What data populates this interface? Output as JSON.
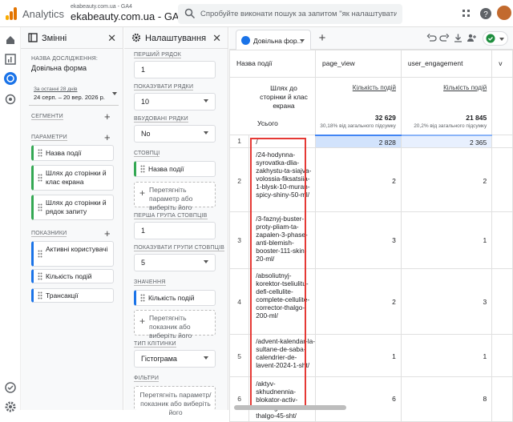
{
  "topbar": {
    "app_name": "Analytics",
    "account_small": "ekabeauty.com.ua - GA4",
    "property": "ekabeauty.com.ua - GA4",
    "search_placeholder": "Спробуйте виконати пошук за запитом \"як налаштувати Ап..."
  },
  "variables_panel": {
    "title": "Змінні",
    "exploration_label": "НАЗВА ДОСЛІДЖЕННЯ:",
    "exploration_name": "Довільна форма",
    "date_label": "За останні 28 днів",
    "date_range": "24 серп. – 20 вер. 2026 р.",
    "segments_label": "СЕГМЕНТИ",
    "dimensions_label": "ПАРАМЕТРИ",
    "dimensions": [
      "Назва події",
      "Шлях до сторінки й клас екрана",
      "Шлях до сторінки й рядок запиту"
    ],
    "metrics_label": "ПОКАЗНИКИ",
    "metrics": [
      "Активні користувачі",
      "Кількість подій",
      "Трансакції"
    ]
  },
  "settings_panel": {
    "title": "Налаштування",
    "first_row_label": "ПЕРШИЙ РЯДОК",
    "first_row": "1",
    "show_rows_label": "ПОКАЗУВАТИ РЯДКИ",
    "show_rows": "10",
    "nested_rows_label": "ВБУДОВАНІ РЯДКИ",
    "nested_rows": "No",
    "columns_label": "СТОВПЦІ",
    "column_chip": "Назва події",
    "drop_dimension": "Перетягніть параметр або виберіть його",
    "first_col_group_label": "ПЕРША ГРУПА СТОВПЦІВ",
    "first_col_group": "1",
    "show_col_groups_label": "ПОКАЗУВАТИ ГРУПИ СТОВПЦІВ",
    "show_col_groups": "5",
    "values_label": "ЗНАЧЕННЯ",
    "value_chip": "Кількість подій",
    "drop_metric": "Перетягніть показник або виберіть його",
    "cell_type_label": "ТИП КЛІТИНКИ",
    "cell_type": "Гістограма",
    "filters_label": "ФІЛЬТРИ",
    "drop_filter": "Перетягніть параметр/ показник або виберіть його"
  },
  "report": {
    "tab_name": "Довільна фор...",
    "header_dim": "Назва події",
    "col1": "page_view",
    "col2": "user_engagement",
    "col3": "v",
    "row_dim_label": "Шлях до сторінки й клас екрана",
    "metric_label": "Кількість подій",
    "totals_label": "Усього",
    "total1": "32 629",
    "total1_pct": "30,18% від загального підсумку",
    "total2": "21 845",
    "total2_pct": "20,2% від загального підсумку",
    "rows": [
      {
        "n": "1",
        "path": "/",
        "v1": "2 828",
        "v2": "2 365"
      },
      {
        "n": "2",
        "path": "/24-hodynna-syrovatka-dlia-zakhystu-ta-siajva-volossia-fiksatsiia-1-blysk-10-muran-spicy-shiny-50-ml/",
        "v1": "2",
        "v2": "2"
      },
      {
        "n": "3",
        "path": "/3-faznyj-buster-proty-pliam-ta-zapalen-3-phase-anti-blemish-booster-111-skin-20-ml/",
        "v1": "3",
        "v2": "1"
      },
      {
        "n": "4",
        "path": "/absoliutnyj-korektor-tseliulitu-defi-cellulite-complete-cellulite-corrector-thalgo-200-ml/",
        "v1": "2",
        "v2": "3"
      },
      {
        "n": "5",
        "path": "/advent-kalendar-la-sultane-de-saba-calendrier-de-lavent-2024-1-sht/",
        "v1": "1",
        "v2": "1"
      },
      {
        "n": "6",
        "path": "/aktyv-skhudnennia-blokator-activ-refining-blocker-thalgo-45-sht/",
        "v1": "6",
        "v2": "8"
      }
    ]
  },
  "colors": {
    "accent": "#1a73e8",
    "dimension": "#34a853",
    "highlight": "#e53935",
    "bar": "#c6dafc"
  }
}
